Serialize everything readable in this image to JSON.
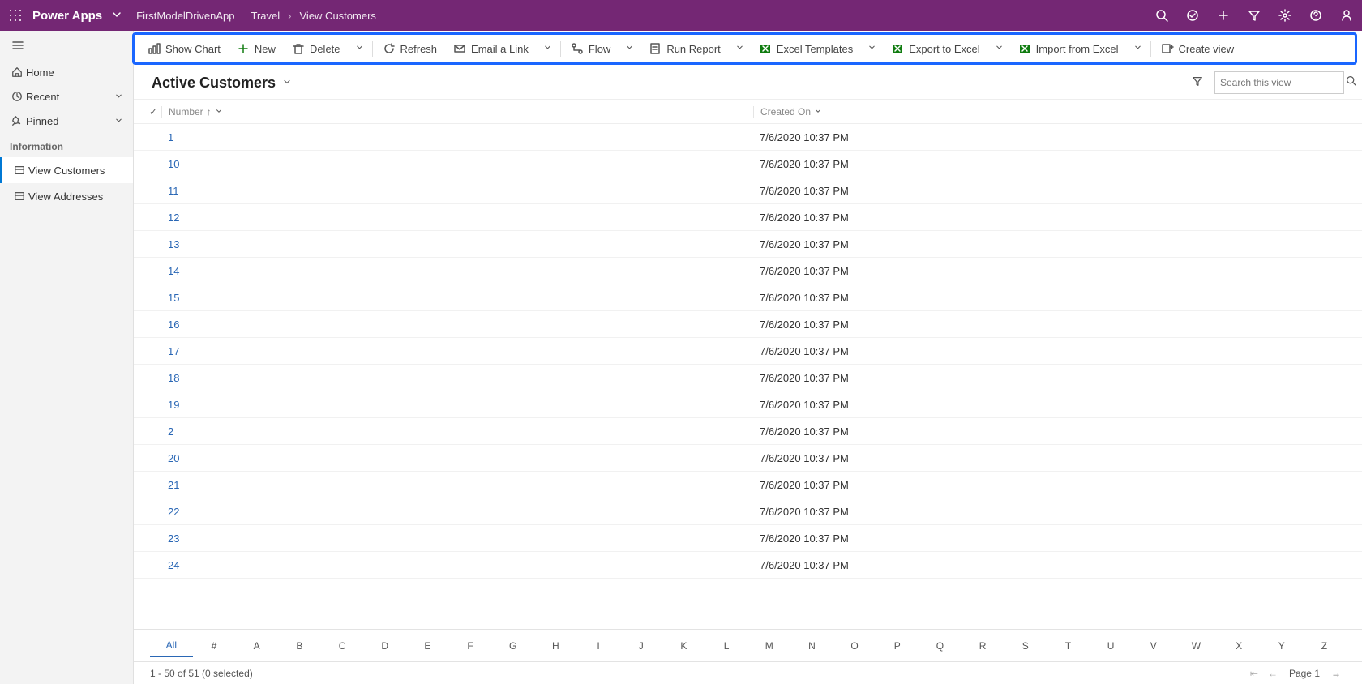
{
  "header": {
    "brand": "Power Apps",
    "app_name": "FirstModelDrivenApp",
    "breadcrumb": [
      "Travel",
      "View Customers"
    ]
  },
  "sidebar": {
    "quick": [
      {
        "icon": "home",
        "label": "Home"
      },
      {
        "icon": "clock",
        "label": "Recent",
        "chev": true
      },
      {
        "icon": "pin",
        "label": "Pinned",
        "chev": true
      }
    ],
    "section": "Information",
    "items": [
      {
        "label": "View Customers",
        "active": true,
        "icon": "entity"
      },
      {
        "label": "View Addresses",
        "active": false,
        "icon": "entity2"
      }
    ]
  },
  "commands": {
    "show_chart": "Show Chart",
    "new": "New",
    "delete": "Delete",
    "refresh": "Refresh",
    "email": "Email a Link",
    "flow": "Flow",
    "run_report": "Run Report",
    "excel_templates": "Excel Templates",
    "export_excel": "Export to Excel",
    "import_excel": "Import from Excel",
    "create_view": "Create view"
  },
  "view": {
    "title": "Active Customers",
    "search_placeholder": "Search this view",
    "columns": {
      "number": "Number",
      "created": "Created On"
    }
  },
  "rows": [
    {
      "n": "1",
      "d": "7/6/2020 10:37 PM"
    },
    {
      "n": "10",
      "d": "7/6/2020 10:37 PM"
    },
    {
      "n": "11",
      "d": "7/6/2020 10:37 PM"
    },
    {
      "n": "12",
      "d": "7/6/2020 10:37 PM"
    },
    {
      "n": "13",
      "d": "7/6/2020 10:37 PM"
    },
    {
      "n": "14",
      "d": "7/6/2020 10:37 PM"
    },
    {
      "n": "15",
      "d": "7/6/2020 10:37 PM"
    },
    {
      "n": "16",
      "d": "7/6/2020 10:37 PM"
    },
    {
      "n": "17",
      "d": "7/6/2020 10:37 PM"
    },
    {
      "n": "18",
      "d": "7/6/2020 10:37 PM"
    },
    {
      "n": "19",
      "d": "7/6/2020 10:37 PM"
    },
    {
      "n": "2",
      "d": "7/6/2020 10:37 PM"
    },
    {
      "n": "20",
      "d": "7/6/2020 10:37 PM"
    },
    {
      "n": "21",
      "d": "7/6/2020 10:37 PM"
    },
    {
      "n": "22",
      "d": "7/6/2020 10:37 PM"
    },
    {
      "n": "23",
      "d": "7/6/2020 10:37 PM"
    },
    {
      "n": "24",
      "d": "7/6/2020 10:37 PM"
    }
  ],
  "alpha": [
    "All",
    "#",
    "A",
    "B",
    "C",
    "D",
    "E",
    "F",
    "G",
    "H",
    "I",
    "J",
    "K",
    "L",
    "M",
    "N",
    "O",
    "P",
    "Q",
    "R",
    "S",
    "T",
    "U",
    "V",
    "W",
    "X",
    "Y",
    "Z"
  ],
  "status": {
    "count": "1 - 50 of 51 (0 selected)",
    "page": "Page 1"
  }
}
